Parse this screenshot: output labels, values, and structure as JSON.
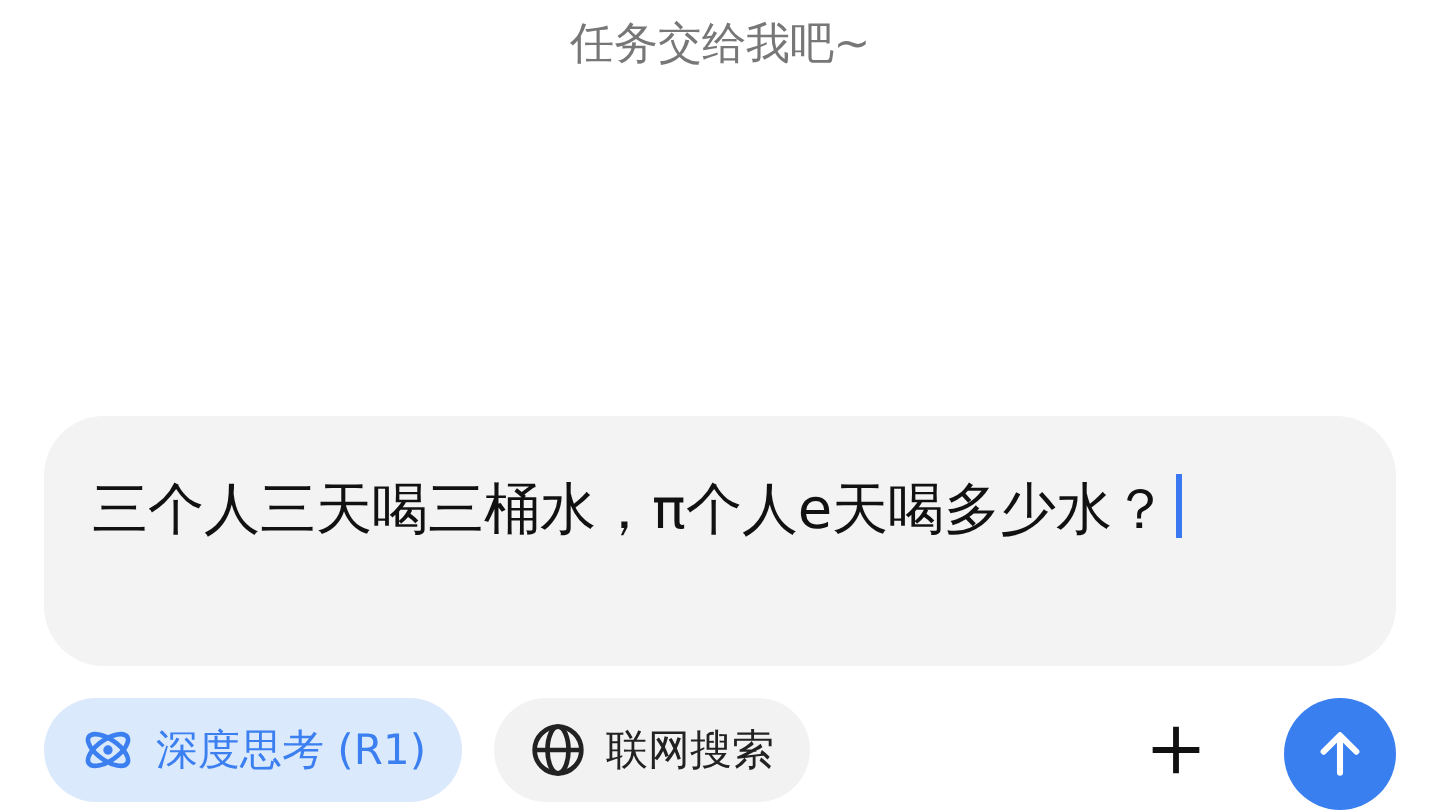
{
  "subtitle": "任务交给我吧~",
  "input": {
    "value": "三个人三天喝三桶水，π个人e天喝多少水？"
  },
  "toggles": [
    {
      "kind": "deepthink",
      "label": "深度思考 (R1)",
      "selected": true
    },
    {
      "kind": "websearch",
      "label": "联网搜索",
      "selected": false
    }
  ]
}
